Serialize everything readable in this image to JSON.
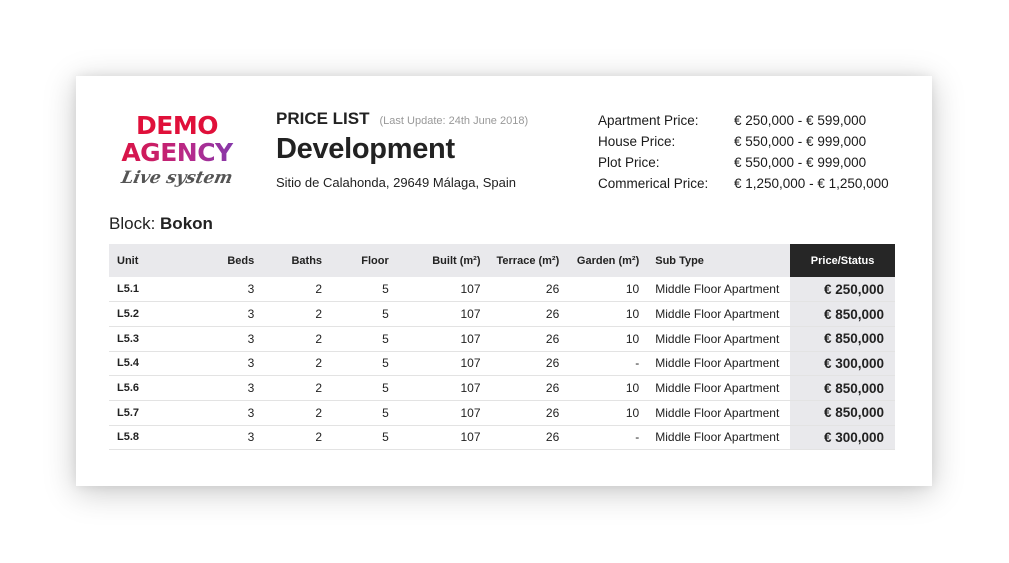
{
  "logo": {
    "line1": "DEMO",
    "line2": "AGENCY",
    "tagline": "Live system",
    "colors": {
      "primary": "#e0103a",
      "secondary": "#7b3bb0"
    }
  },
  "header": {
    "price_list_label": "PRICE LIST",
    "last_update": "(Last Update: 24th June 2018)",
    "development_name": "Development",
    "address": "Sitio de Calahonda, 29649 Málaga, Spain"
  },
  "prices": [
    {
      "label": "Apartment Price:",
      "value": "€ 250,000 - € 599,000"
    },
    {
      "label": "House Price:",
      "value": "€ 550,000 - € 999,000"
    },
    {
      "label": "Plot Price:",
      "value": "€ 550,000 - € 999,000"
    },
    {
      "label": "Commerical Price:",
      "value": "€ 1,250,000 - € 1,250,000"
    }
  ],
  "block": {
    "label": "Block:",
    "name": "Bokon"
  },
  "table": {
    "headers": {
      "unit": "Unit",
      "beds": "Beds",
      "baths": "Baths",
      "floor": "Floor",
      "built": "Built (m²)",
      "terrace": "Terrace (m²)",
      "garden": "Garden (m²)",
      "subtype": "Sub Type",
      "status": "Price/Status"
    },
    "rows": [
      {
        "unit": "L5.1",
        "beds": "3",
        "baths": "2",
        "floor": "5",
        "built": "107",
        "terrace": "26",
        "garden": "10",
        "subtype": "Middle Floor Apartment",
        "price": "€ 250,000"
      },
      {
        "unit": "L5.2",
        "beds": "3",
        "baths": "2",
        "floor": "5",
        "built": "107",
        "terrace": "26",
        "garden": "10",
        "subtype": "Middle Floor Apartment",
        "price": "€ 850,000"
      },
      {
        "unit": "L5.3",
        "beds": "3",
        "baths": "2",
        "floor": "5",
        "built": "107",
        "terrace": "26",
        "garden": "10",
        "subtype": "Middle Floor Apartment",
        "price": "€ 850,000"
      },
      {
        "unit": "L5.4",
        "beds": "3",
        "baths": "2",
        "floor": "5",
        "built": "107",
        "terrace": "26",
        "garden": "-",
        "subtype": "Middle Floor Apartment",
        "price": "€ 300,000"
      },
      {
        "unit": "L5.6",
        "beds": "3",
        "baths": "2",
        "floor": "5",
        "built": "107",
        "terrace": "26",
        "garden": "10",
        "subtype": "Middle Floor Apartment",
        "price": "€ 850,000"
      },
      {
        "unit": "L5.7",
        "beds": "3",
        "baths": "2",
        "floor": "5",
        "built": "107",
        "terrace": "26",
        "garden": "10",
        "subtype": "Middle Floor Apartment",
        "price": "€ 850,000"
      },
      {
        "unit": "L5.8",
        "beds": "3",
        "baths": "2",
        "floor": "5",
        "built": "107",
        "terrace": "26",
        "garden": "-",
        "subtype": "Middle Floor Apartment",
        "price": "€ 300,000"
      }
    ]
  }
}
